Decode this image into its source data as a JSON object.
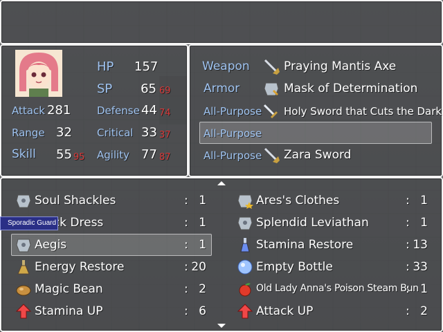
{
  "status": {
    "hp_label": "HP",
    "hp": "157",
    "sp_label": "SP",
    "sp": "65",
    "sp_bonus": "69",
    "stats": [
      {
        "label": "Attack",
        "value": "281",
        "bonus": ""
      },
      {
        "label": "Defense",
        "value": "44",
        "bonus": "74"
      },
      {
        "label": "Range",
        "value": "32",
        "bonus": ""
      },
      {
        "label": "Critical",
        "value": "33",
        "bonus": "37"
      },
      {
        "label": "Skill",
        "value": "55",
        "bonus": "95"
      },
      {
        "label": "Agility",
        "value": "77",
        "bonus": "87"
      }
    ]
  },
  "equipment": [
    {
      "slot": "Weapon",
      "item": "Praying Mantis Axe",
      "icon": "axe-icon"
    },
    {
      "slot": "Armor",
      "item": "Mask of Determination",
      "icon": "mask-icon"
    },
    {
      "slot": "All-Purpose",
      "item": "Holy Sword that Cuts the Dark",
      "icon": "sword-icon"
    },
    {
      "slot": "All-Purpose",
      "item": "",
      "icon": ""
    },
    {
      "slot": "All-Purpose",
      "item": "Zara Sword",
      "icon": "axe-icon"
    }
  ],
  "inventory": [
    {
      "name": "Soul Shackles",
      "sep": ":",
      "qty": "1",
      "icon": "armor-icon"
    },
    {
      "name": "Ares's Clothes",
      "sep": ":",
      "qty": "1",
      "icon": "armor-star-icon"
    },
    {
      "name": "Black Dress",
      "sep": ":",
      "qty": "1",
      "icon": "armor-icon"
    },
    {
      "name": "Splendid Leviathan",
      "sep": ":",
      "qty": "1",
      "icon": "armor-icon"
    },
    {
      "name": "Aegis",
      "sep": ":",
      "qty": "1",
      "icon": "armor-icon"
    },
    {
      "name": "Stamina Restore",
      "sep": ":",
      "qty": "13",
      "icon": "potion-icon"
    },
    {
      "name": "Energy Restore",
      "sep": ":",
      "qty": "20",
      "icon": "flask-icon"
    },
    {
      "name": "Empty Bottle",
      "sep": ":",
      "qty": "33",
      "icon": "orb-icon"
    },
    {
      "name": "Magic Bean",
      "sep": ":",
      "qty": "2",
      "icon": "bean-icon"
    },
    {
      "name": "Old Lady Anna's Poison Steam Bun",
      "sep": ":",
      "qty": "1",
      "icon": "apple-icon"
    },
    {
      "name": "Stamina UP",
      "sep": ":",
      "qty": "6",
      "icon": "up-arrow-icon"
    },
    {
      "name": "Attack UP",
      "sep": ":",
      "qty": "2",
      "icon": "up-arrow-icon"
    }
  ],
  "popup": {
    "label": "Sporadic Guard"
  },
  "colors": {
    "label_blue": "#9fc3f0",
    "bonus_red": "#d83a3a",
    "popup_bg": "#2a2f86"
  }
}
